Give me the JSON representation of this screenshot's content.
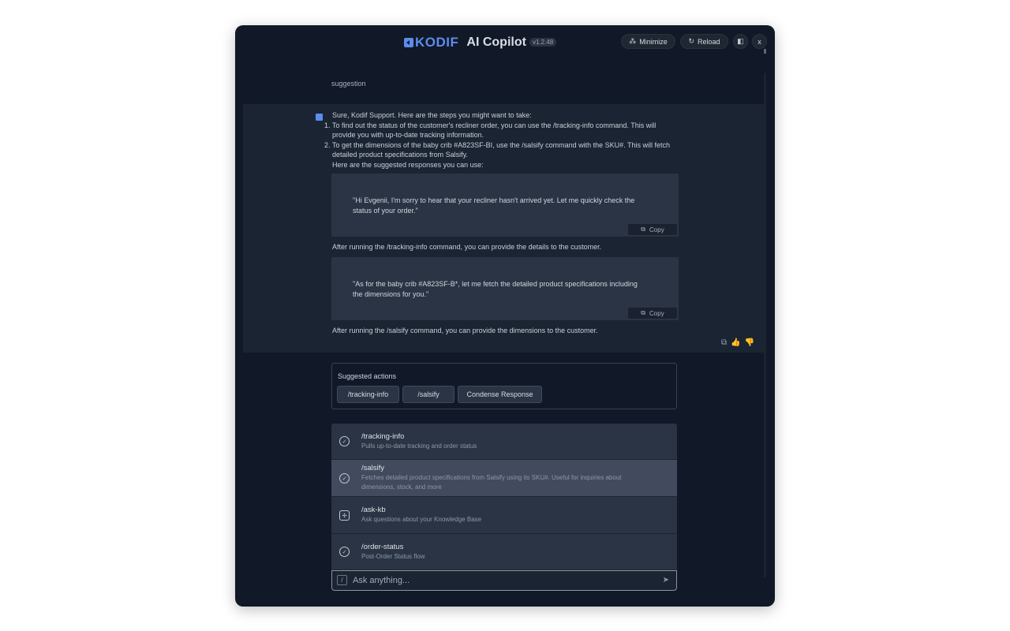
{
  "header": {
    "logo_text": "KODIF",
    "title": "AI Copilot",
    "version": "v1.2.48",
    "minimize_label": "Minimize",
    "reload_label": "Reload",
    "close_label": "x"
  },
  "conversation": {
    "user_message": "suggestion",
    "intro": "Sure, Kodif Support. Here are the steps you might want to take:",
    "steps": [
      {
        "num": "1.",
        "text": "To find out the status of the customer's recliner order, you can use the /tracking-info command. This will provide you with up-to-date tracking information."
      },
      {
        "num": "2.",
        "text": "To get the dimensions of the baby crib #A823SF-BI, use the /salsify command with the SKU#. This will fetch detailed product specifications from Salsify."
      }
    ],
    "responses_intro": "Here are the suggested responses you can use:",
    "response_1": "\"Hi Evgenii, I'm sorry to hear that your recliner hasn't arrived yet. Let me quickly check the status of your order.\"",
    "after_1": "After running the /tracking-info command, you can provide the details to the customer.",
    "response_2": "\"As for the baby crib #A823SF-B*, let me fetch the detailed product specifications including the dimensions for you.\"",
    "after_2": "After running the /salsify command, you can provide the dimensions to the customer.",
    "copy_label": "Copy"
  },
  "suggested_actions": {
    "title": "Suggested actions",
    "chips": [
      "/tracking-info",
      "/salsify",
      "Condense Response"
    ]
  },
  "commands": [
    {
      "name": "/tracking-info",
      "desc": "Pulls up-to-date tracking and order status",
      "icon": "check-circle-icon"
    },
    {
      "name": "/salsify",
      "desc": "Fetches detailed product specifications from Salsify using its SKU#. Useful for inquiries about dimensions, stock, and more",
      "icon": "check-circle-icon"
    },
    {
      "name": "/ask-kb",
      "desc": "Ask questions about your Knowledge Base",
      "icon": "puzzle-icon"
    },
    {
      "name": "/order-status",
      "desc": "Post-Order Status flow",
      "icon": "check-circle-icon"
    }
  ],
  "input": {
    "placeholder": "Ask anything...",
    "slash_hint": "/"
  }
}
